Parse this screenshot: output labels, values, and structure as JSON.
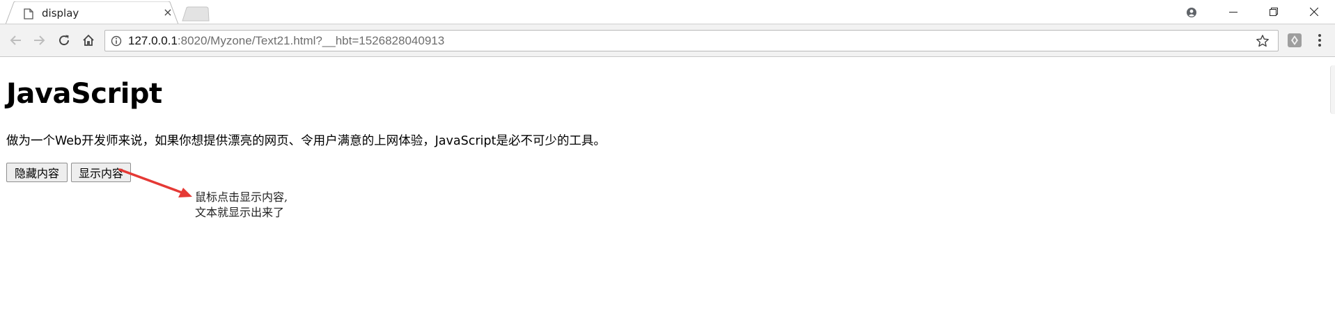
{
  "browser": {
    "tab": {
      "title": "display",
      "close_symbol": "×"
    },
    "address": {
      "host": "127.0.0.1",
      "rest": ":8020/Myzone/Text21.html?__hbt=1526828040913"
    },
    "icons": {
      "page": "document-icon",
      "back": "back-arrow-icon",
      "forward": "forward-arrow-icon",
      "reload": "reload-icon",
      "home": "home-icon",
      "info": "info-icon",
      "bookmark": "star-icon",
      "extension": "extension-icon",
      "menu": "kebab-menu-icon",
      "account": "account-icon",
      "minimize": "minimize-icon",
      "restore": "restore-icon",
      "close": "close-icon"
    }
  },
  "page": {
    "heading": "JavaScript",
    "paragraph": "做为一个Web开发师来说，如果你想提供漂亮的网页、令用户满意的上网体验，JavaScript是必不可少的工具。",
    "buttons": {
      "hide": "隐藏内容",
      "show": "显示内容"
    }
  },
  "annotation": {
    "line1": "鼠标点击显示内容,",
    "line2": "文本就显示出来了",
    "arrow_color": "#e53935"
  }
}
